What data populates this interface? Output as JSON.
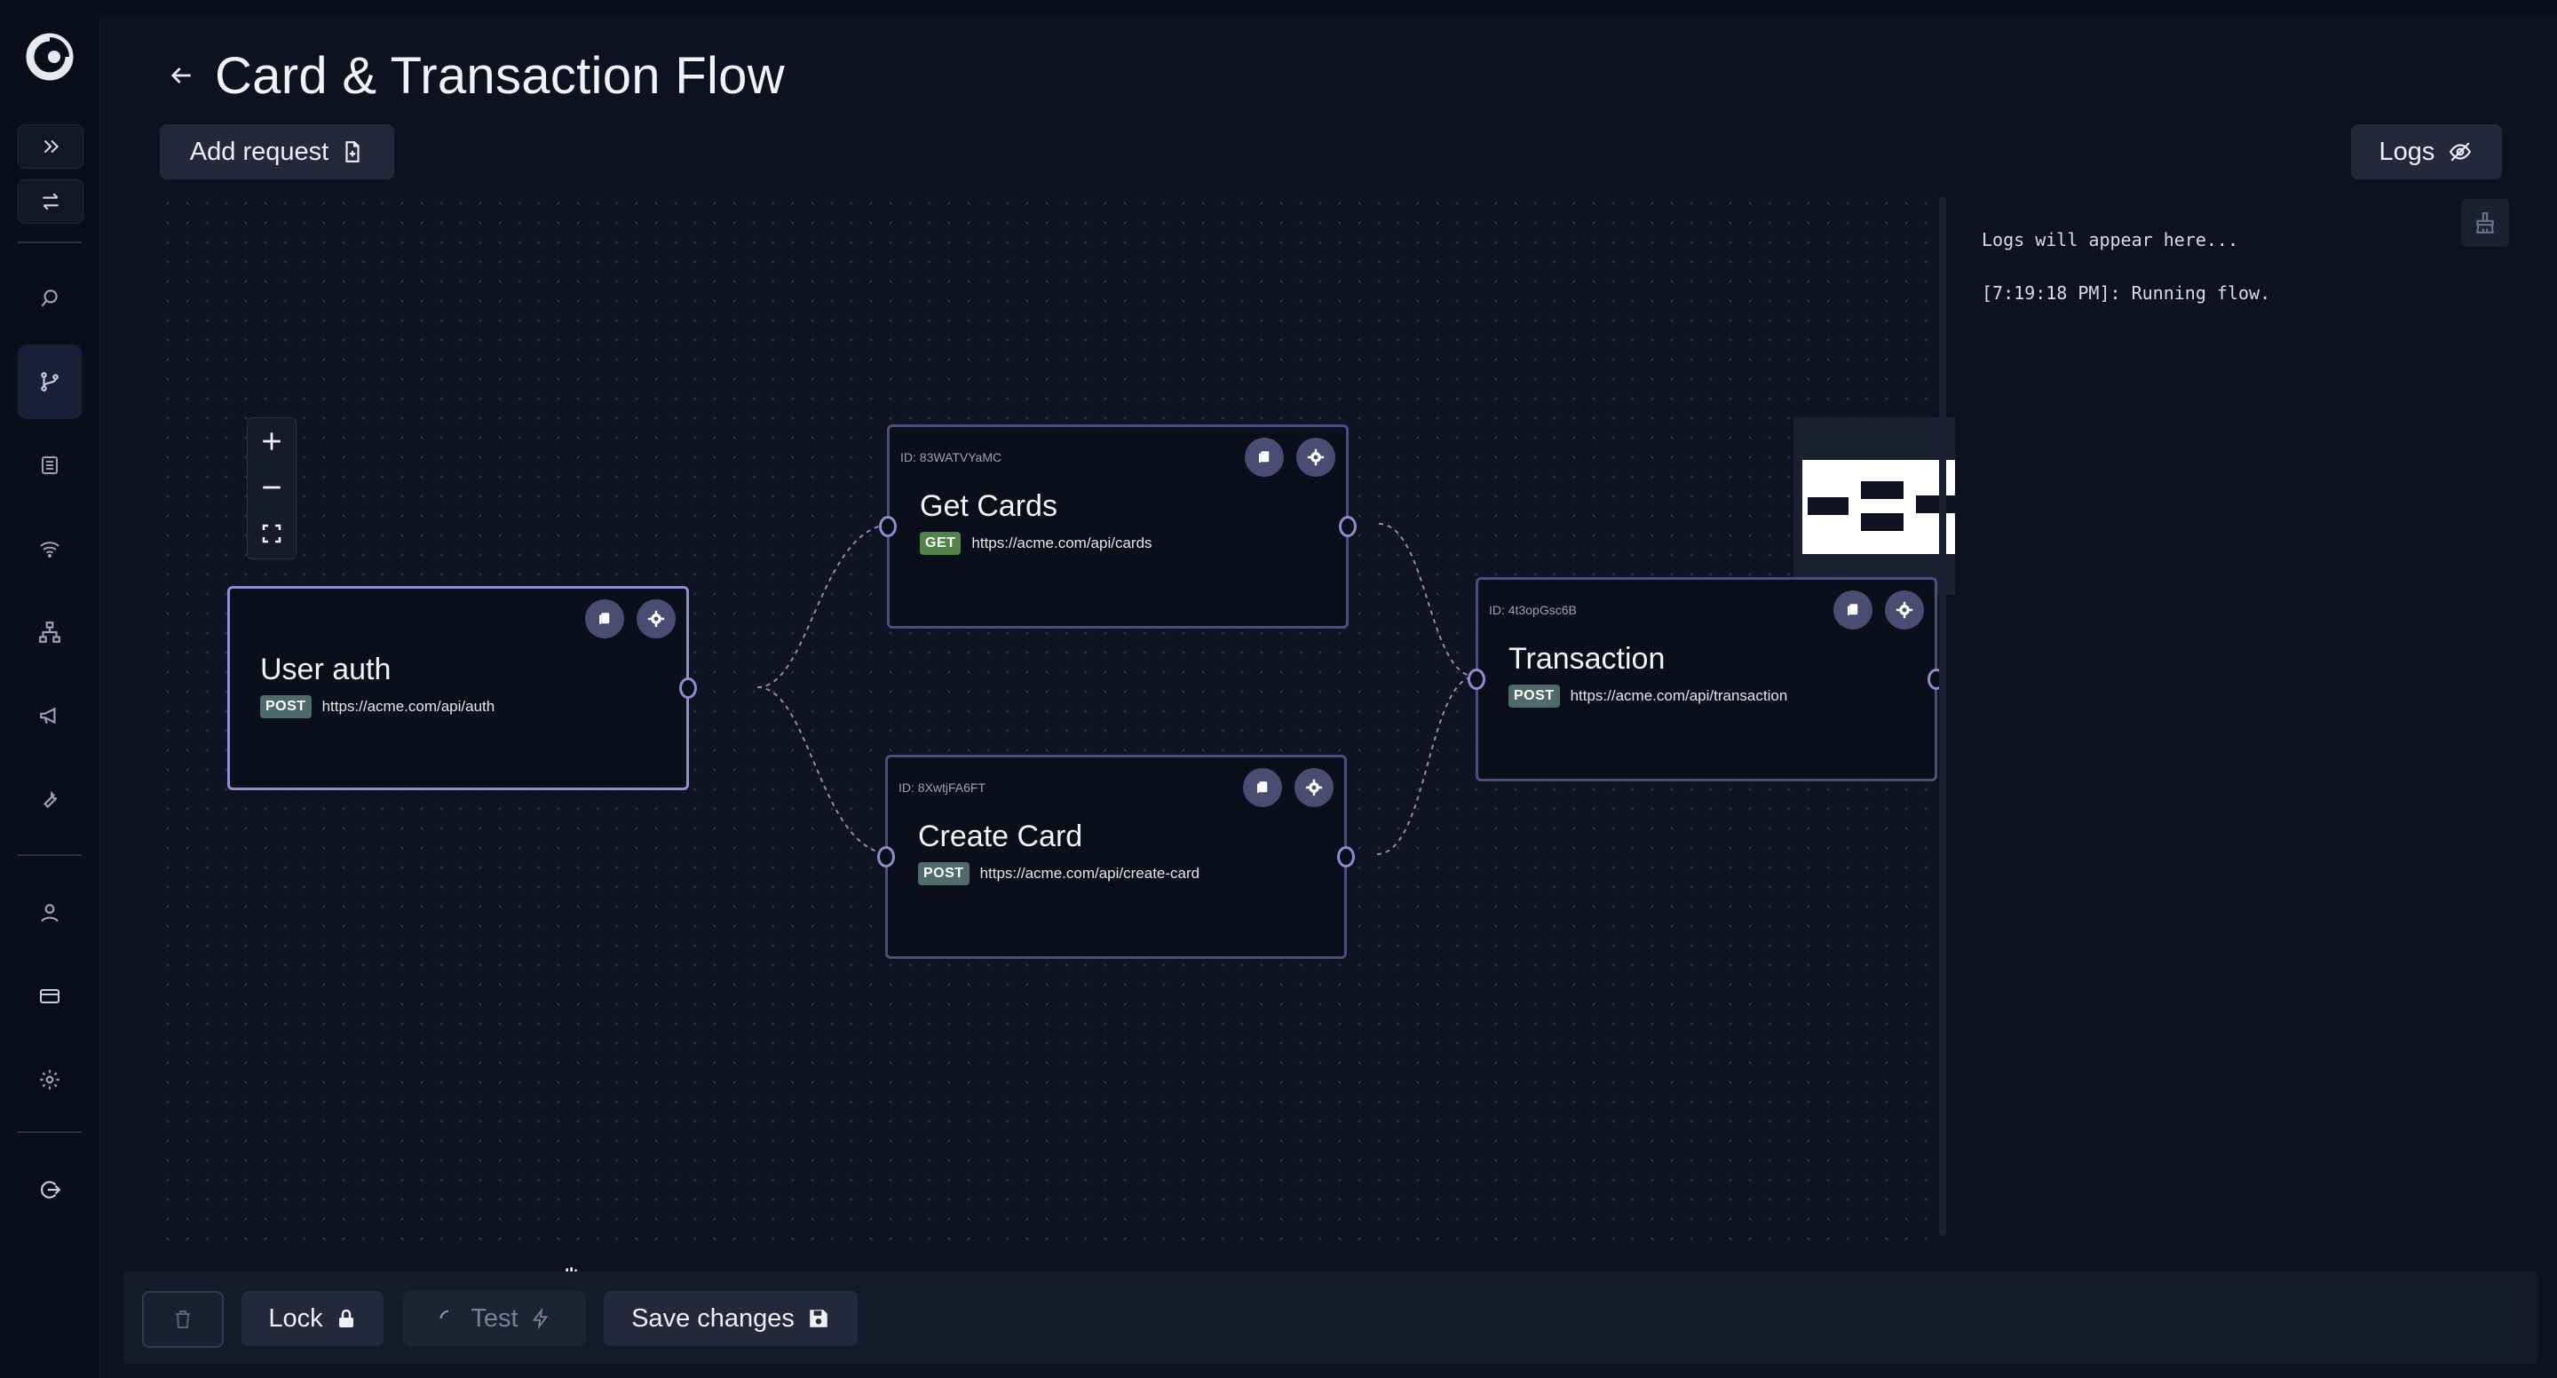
{
  "app": {
    "title": "Card & Transaction Flow",
    "back_icon": "arrow-left-icon"
  },
  "sidebar": {
    "items": [
      {
        "name": "expand",
        "icon": "double-chevron-right-icon"
      },
      {
        "name": "switch",
        "icon": "swap-arrows-icon"
      },
      {
        "name": "explore",
        "icon": "search-icon"
      },
      {
        "name": "flows",
        "icon": "git-branch-icon",
        "active": true
      },
      {
        "name": "docs",
        "icon": "list-icon"
      },
      {
        "name": "network",
        "icon": "wifi-icon"
      },
      {
        "name": "structure",
        "icon": "sitemap-icon"
      },
      {
        "name": "announcements",
        "icon": "megaphone-icon"
      },
      {
        "name": "tools",
        "icon": "wrench-icon"
      },
      {
        "name": "profile",
        "icon": "user-icon"
      },
      {
        "name": "billing",
        "icon": "credit-card-icon"
      },
      {
        "name": "settings",
        "icon": "gear-icon"
      },
      {
        "name": "logout",
        "icon": "logout-icon"
      }
    ]
  },
  "toolbar": {
    "add_request_label": "Add request",
    "logs_label": "Logs"
  },
  "logs": {
    "placeholder": "Logs will appear here...",
    "entries": [
      "[7:19:18 PM]: Running flow."
    ]
  },
  "nodes": [
    {
      "id_label": "",
      "title": "User auth",
      "method": "POST",
      "url": "https://acme.com/api/auth"
    },
    {
      "id_label": "ID: 83WATVYaMC",
      "title": "Get Cards",
      "method": "GET",
      "url": "https://acme.com/api/cards"
    },
    {
      "id_label": "ID: 8XwtjFA6FT",
      "title": "Create Card",
      "method": "POST",
      "url": "https://acme.com/api/create-card"
    },
    {
      "id_label": "ID: 4t3opGsc6B",
      "title": "Transaction",
      "method": "POST",
      "url": "https://acme.com/api/transaction"
    }
  ],
  "bottombar": {
    "lock_label": "Lock",
    "test_label": "Test",
    "save_label": "Save changes"
  },
  "colors": {
    "background": "#0d1120",
    "node_border": "#4b4f7e",
    "node_border_selected": "#8e8fd4",
    "badge_post": "#4f6a68",
    "badge_get": "#52834a"
  }
}
